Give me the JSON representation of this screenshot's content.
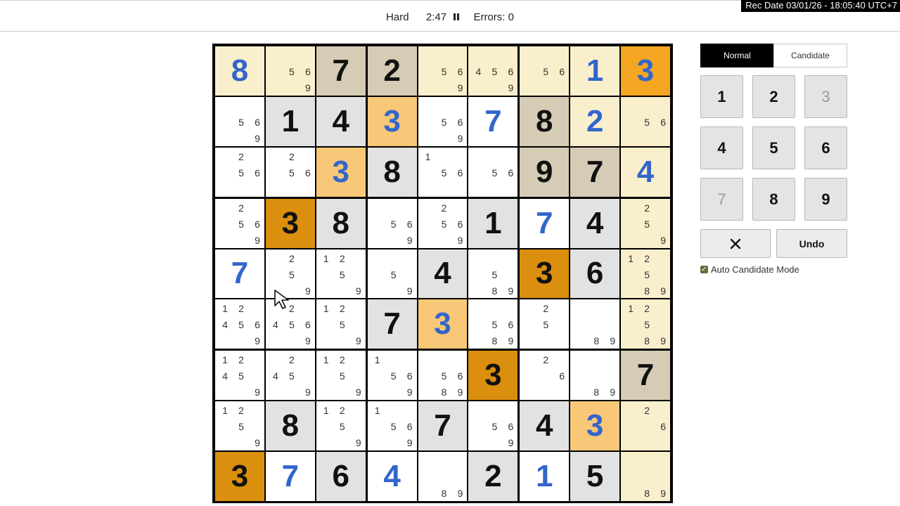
{
  "header": {
    "difficulty": "Hard",
    "timer": "2:47",
    "errors_label": "Errors: 0",
    "rec_date": "Rec Date 03/01/26 - 18:05:40 UTC+7"
  },
  "colors": {
    "given_text": "#111111",
    "user_text": "#3366cc",
    "highlight_light": "#f9efcc",
    "highlight_tan": "#d6cbb5",
    "highlight_orange": "#f5a623",
    "highlight_lightorange": "#f8c878",
    "highlight_darkorange": "#db8f0e",
    "highlight_gray": "#e2e2e2",
    "empty": "#ffffff"
  },
  "board": {
    "rows": [
      [
        {
          "v": "8",
          "t": "user",
          "bg": "light"
        },
        {
          "c": [
            "5",
            "6",
            "9"
          ],
          "bg": "light"
        },
        {
          "v": "7",
          "t": "given",
          "bg": "tan"
        },
        {
          "v": "2",
          "t": "given",
          "bg": "tan"
        },
        {
          "c": [
            "5",
            "6",
            "9"
          ],
          "bg": "light"
        },
        {
          "c": [
            "4",
            "5",
            "6",
            "9"
          ],
          "bg": "light"
        },
        {
          "c": [
            "5",
            "6"
          ],
          "bg": "light"
        },
        {
          "v": "1",
          "t": "user",
          "bg": "light"
        },
        {
          "v": "3",
          "t": "user",
          "bg": "orange"
        }
      ],
      [
        {
          "c": [
            "5",
            "6",
            "9"
          ],
          "bg": "empty"
        },
        {
          "v": "1",
          "t": "given",
          "bg": "gray"
        },
        {
          "v": "4",
          "t": "given",
          "bg": "gray"
        },
        {
          "v": "3",
          "t": "user",
          "bg": "lightorange"
        },
        {
          "c": [
            "5",
            "6",
            "9"
          ],
          "bg": "empty"
        },
        {
          "v": "7",
          "t": "user",
          "bg": "empty"
        },
        {
          "v": "8",
          "t": "given",
          "bg": "tan"
        },
        {
          "v": "2",
          "t": "user",
          "bg": "light"
        },
        {
          "c": [
            "5",
            "6"
          ],
          "bg": "light"
        }
      ],
      [
        {
          "c": [
            "2",
            "5",
            "6"
          ],
          "bg": "empty"
        },
        {
          "c": [
            "2",
            "5",
            "6"
          ],
          "bg": "empty"
        },
        {
          "v": "3",
          "t": "user",
          "bg": "lightorange"
        },
        {
          "v": "8",
          "t": "given",
          "bg": "gray"
        },
        {
          "c": [
            "1",
            "5",
            "6"
          ],
          "bg": "empty"
        },
        {
          "c": [
            "5",
            "6"
          ],
          "bg": "empty"
        },
        {
          "v": "9",
          "t": "given",
          "bg": "tan"
        },
        {
          "v": "7",
          "t": "given",
          "bg": "tan"
        },
        {
          "v": "4",
          "t": "user",
          "bg": "light"
        }
      ],
      [
        {
          "c": [
            "2",
            "5",
            "6",
            "9"
          ],
          "bg": "empty"
        },
        {
          "v": "3",
          "t": "given",
          "bg": "darkorange"
        },
        {
          "v": "8",
          "t": "given",
          "bg": "gray"
        },
        {
          "c": [
            "5",
            "6",
            "9"
          ],
          "bg": "empty"
        },
        {
          "c": [
            "2",
            "5",
            "6",
            "9"
          ],
          "bg": "empty"
        },
        {
          "v": "1",
          "t": "given",
          "bg": "gray"
        },
        {
          "v": "7",
          "t": "user",
          "bg": "empty"
        },
        {
          "v": "4",
          "t": "given",
          "bg": "gray"
        },
        {
          "c": [
            "2",
            "5",
            "9"
          ],
          "bg": "light"
        }
      ],
      [
        {
          "v": "7",
          "t": "user",
          "bg": "empty"
        },
        {
          "c": [
            "2",
            "5",
            "9"
          ],
          "bg": "empty"
        },
        {
          "c": [
            "1",
            "2",
            "5",
            "9"
          ],
          "bg": "empty"
        },
        {
          "c": [
            "5",
            "9"
          ],
          "bg": "empty"
        },
        {
          "v": "4",
          "t": "given",
          "bg": "gray"
        },
        {
          "c": [
            "5",
            "8",
            "9"
          ],
          "bg": "empty"
        },
        {
          "v": "3",
          "t": "given",
          "bg": "darkorange"
        },
        {
          "v": "6",
          "t": "given",
          "bg": "gray"
        },
        {
          "c": [
            "1",
            "2",
            "5",
            "8",
            "9"
          ],
          "bg": "light"
        }
      ],
      [
        {
          "c": [
            "1",
            "2",
            "4",
            "5",
            "6",
            "9"
          ],
          "bg": "empty"
        },
        {
          "c": [
            "2",
            "4",
            "5",
            "6",
            "9"
          ],
          "bg": "empty"
        },
        {
          "c": [
            "1",
            "2",
            "5",
            "9"
          ],
          "bg": "empty"
        },
        {
          "v": "7",
          "t": "given",
          "bg": "gray"
        },
        {
          "v": "3",
          "t": "user",
          "bg": "lightorange"
        },
        {
          "c": [
            "5",
            "6",
            "8",
            "9"
          ],
          "bg": "empty"
        },
        {
          "c": [
            "2",
            "5"
          ],
          "bg": "empty"
        },
        {
          "c": [
            "8",
            "9"
          ],
          "bg": "empty"
        },
        {
          "c": [
            "1",
            "2",
            "5",
            "8",
            "9"
          ],
          "bg": "light"
        }
      ],
      [
        {
          "c": [
            "1",
            "2",
            "4",
            "5",
            "9"
          ],
          "bg": "empty"
        },
        {
          "c": [
            "2",
            "4",
            "5",
            "9"
          ],
          "bg": "empty"
        },
        {
          "c": [
            "1",
            "2",
            "5",
            "9"
          ],
          "bg": "empty"
        },
        {
          "c": [
            "1",
            "5",
            "6",
            "9"
          ],
          "bg": "empty"
        },
        {
          "c": [
            "5",
            "6",
            "8",
            "9"
          ],
          "bg": "empty"
        },
        {
          "v": "3",
          "t": "given",
          "bg": "darkorange"
        },
        {
          "c": [
            "2",
            "6"
          ],
          "bg": "empty"
        },
        {
          "c": [
            "8",
            "9"
          ],
          "bg": "empty"
        },
        {
          "v": "7",
          "t": "given",
          "bg": "tan"
        }
      ],
      [
        {
          "c": [
            "1",
            "2",
            "5",
            "9"
          ],
          "bg": "empty"
        },
        {
          "v": "8",
          "t": "given",
          "bg": "gray"
        },
        {
          "c": [
            "1",
            "2",
            "5",
            "9"
          ],
          "bg": "empty"
        },
        {
          "c": [
            "1",
            "5",
            "6",
            "9"
          ],
          "bg": "empty"
        },
        {
          "v": "7",
          "t": "given",
          "bg": "gray"
        },
        {
          "c": [
            "5",
            "6",
            "9"
          ],
          "bg": "empty"
        },
        {
          "v": "4",
          "t": "given",
          "bg": "gray"
        },
        {
          "v": "3",
          "t": "user",
          "bg": "lightorange"
        },
        {
          "c": [
            "2",
            "6"
          ],
          "bg": "light"
        }
      ],
      [
        {
          "v": "3",
          "t": "given",
          "bg": "darkorange"
        },
        {
          "v": "7",
          "t": "user",
          "bg": "empty"
        },
        {
          "v": "6",
          "t": "given",
          "bg": "gray"
        },
        {
          "v": "4",
          "t": "user",
          "bg": "empty"
        },
        {
          "c": [
            "8",
            "9"
          ],
          "bg": "empty"
        },
        {
          "v": "2",
          "t": "given",
          "bg": "gray"
        },
        {
          "v": "1",
          "t": "user",
          "bg": "empty"
        },
        {
          "v": "5",
          "t": "given",
          "bg": "gray"
        },
        {
          "c": [
            "8",
            "9"
          ],
          "bg": "light"
        }
      ]
    ]
  },
  "controls": {
    "mode_normal": "Normal",
    "mode_candidate": "Candidate",
    "numbers": [
      {
        "label": "1",
        "dim": false
      },
      {
        "label": "2",
        "dim": false
      },
      {
        "label": "3",
        "dim": true
      },
      {
        "label": "4",
        "dim": false
      },
      {
        "label": "5",
        "dim": false
      },
      {
        "label": "6",
        "dim": false
      },
      {
        "label": "7",
        "dim": true
      },
      {
        "label": "8",
        "dim": false
      },
      {
        "label": "9",
        "dim": false
      }
    ],
    "undo_label": "Undo",
    "auto_candidate_label": "Auto Candidate Mode",
    "auto_candidate_checked": true
  }
}
